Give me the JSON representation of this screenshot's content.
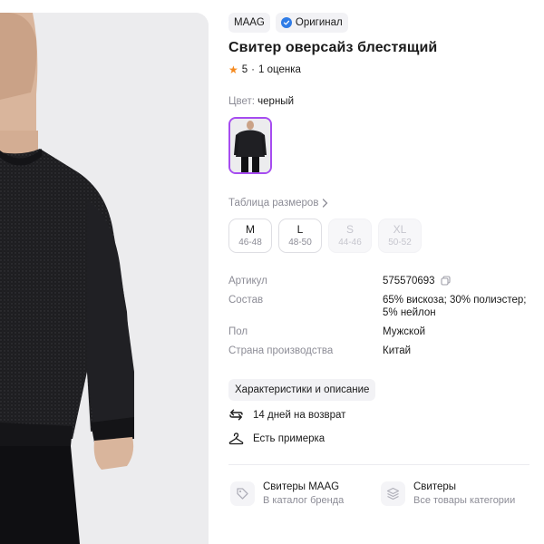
{
  "product": {
    "brand": "MAAG",
    "original_badge": "Оригинал",
    "title": "Свитер оверсайз блестящий",
    "rating": {
      "score": "5",
      "separator": "·",
      "count_text": "1 оценка"
    },
    "color": {
      "label": "Цвет:",
      "value": "черный"
    },
    "size_table_label": "Таблица размеров",
    "sizes": [
      {
        "size": "M",
        "range": "46-48",
        "available": true
      },
      {
        "size": "L",
        "range": "48-50",
        "available": true
      },
      {
        "size": "S",
        "range": "44-46",
        "available": false
      },
      {
        "size": "XL",
        "range": "50-52",
        "available": false
      }
    ],
    "specs": [
      {
        "key": "Артикул",
        "value": "575570693"
      },
      {
        "key": "Состав",
        "value": "65% вискоза; 30% полиэстер; 5% нейлон"
      },
      {
        "key": "Пол",
        "value": "Мужской"
      },
      {
        "key": "Страна производства",
        "value": "Китай"
      }
    ],
    "characteristics_button": "Характеристики и описание",
    "features": [
      {
        "icon": "return-arrows-icon",
        "text": "14 дней на возврат"
      },
      {
        "icon": "hanger-icon",
        "text": "Есть примерка"
      }
    ],
    "categories": [
      {
        "icon": "tag-icon",
        "title": "Свитеры MAAG",
        "subtitle": "В каталог бренда"
      },
      {
        "icon": "layers-icon",
        "title": "Свитеры",
        "subtitle": "Все товары категории"
      }
    ]
  },
  "colors": {
    "accent_purple": "#a64cf0",
    "verified_blue": "#2f7ce6",
    "star_orange": "#f58a1f",
    "muted_text": "#8c8c96"
  }
}
